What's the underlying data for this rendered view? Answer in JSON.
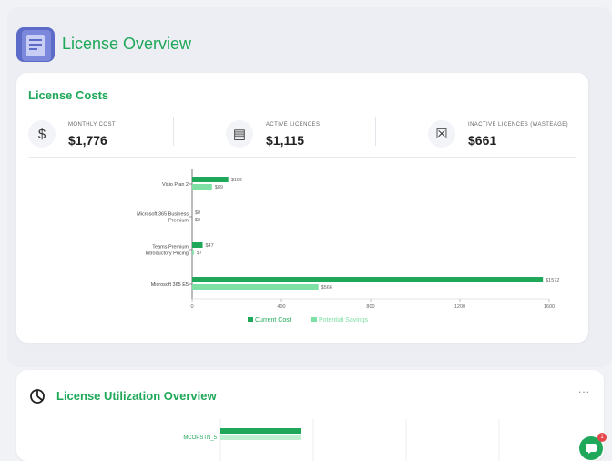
{
  "header": {
    "title": "License Overview",
    "icon": "clipboard-icon"
  },
  "costs": {
    "title": "License Costs",
    "metrics": [
      {
        "label": "MONTHLY COST",
        "value": "$1,776",
        "icon": "dollar-icon",
        "glyph": "$"
      },
      {
        "label": "ACTIVE LICENCES",
        "value": "$1,115",
        "icon": "license-card-icon",
        "glyph": "▤"
      },
      {
        "label": "INACTIVE LICENCES (WASTEAGE)",
        "value": "$661",
        "icon": "x-box-icon",
        "glyph": "☒"
      }
    ]
  },
  "chart_data": {
    "type": "bar",
    "orientation": "horizontal",
    "categories": [
      "Visio Plan 2",
      "Microsoft 365 Business Premium",
      "Teams Premium Introductory Pricing",
      "Microsoft 365 E5"
    ],
    "category_lines": [
      [
        "Visio Plan 2"
      ],
      [
        "Microsoft 365 Business",
        "Premium"
      ],
      [
        "Teams Premium",
        "Introductory Pricing"
      ],
      [
        "Microsoft 365 E5"
      ]
    ],
    "series": [
      {
        "name": "Current Cost",
        "color": "#1fa85a",
        "values": [
          162,
          0,
          47,
          1572
        ],
        "labels": [
          "$162",
          "$0",
          "$47",
          "$1572"
        ]
      },
      {
        "name": "Potential Savings",
        "color": "#7fe0a5",
        "values": [
          89,
          0,
          7,
          566
        ],
        "labels": [
          "$89",
          "$0",
          "$7",
          "$566"
        ]
      }
    ],
    "xlim": [
      0,
      1600
    ],
    "xticks": [
      "0",
      "400",
      "800",
      "1200",
      "1600"
    ],
    "legend": "bottom",
    "grid": false
  },
  "utilization": {
    "title": "License Utilization Overview",
    "menu": "...",
    "row_label": "MCOPSTN_5"
  },
  "fab": {
    "icon": "chat-icon",
    "badge": "1"
  }
}
